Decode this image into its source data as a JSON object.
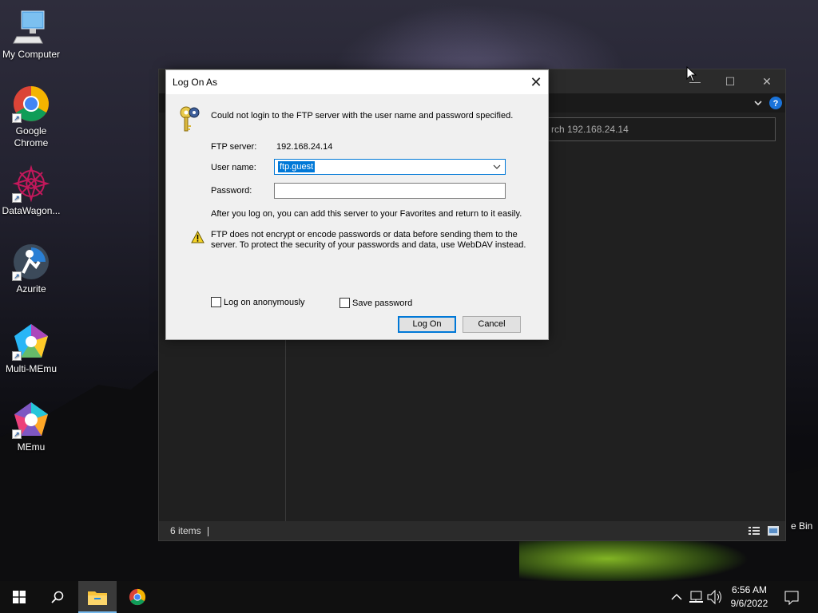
{
  "desktop": {
    "icons": [
      {
        "label": "My Computer"
      },
      {
        "label": "Google Chrome"
      },
      {
        "label": "DataWagon..."
      },
      {
        "label": "Azurite"
      },
      {
        "label": "Multi-MEmu"
      },
      {
        "label": "MEmu"
      }
    ],
    "recycle_partial_label": "e Bin"
  },
  "explorer": {
    "address_text": "rch 192.168.24.14",
    "status_items": "6 items",
    "controls": {
      "minimize": "—",
      "maximize": "☐",
      "close": "✕"
    }
  },
  "dialog": {
    "title": "Log On As",
    "error_message": "Could not login to the FTP server with the user name and password specified.",
    "ftp_server_label": "FTP server:",
    "ftp_server_value": "192.168.24.14",
    "username_label": "User name:",
    "username_value": "ftp.guest",
    "password_label": "Password:",
    "password_value": "",
    "favorites_note": "After you log on, you can add this server to your Favorites and return to it easily.",
    "warning_line1": "FTP does not encrypt or encode passwords or data before sending them to the",
    "warning_line2": "server.  To protect the security of your passwords and data, use WebDAV instead.",
    "anonymous_label": "Log on anonymously",
    "anonymous_checked": false,
    "save_password_label": "Save password",
    "save_password_checked": false,
    "logon_button": "Log On",
    "cancel_button": "Cancel",
    "close_glyph": "✕"
  },
  "taskbar": {
    "time": "6:56 AM",
    "date": "9/6/2022",
    "accent": "#76b9ed"
  }
}
